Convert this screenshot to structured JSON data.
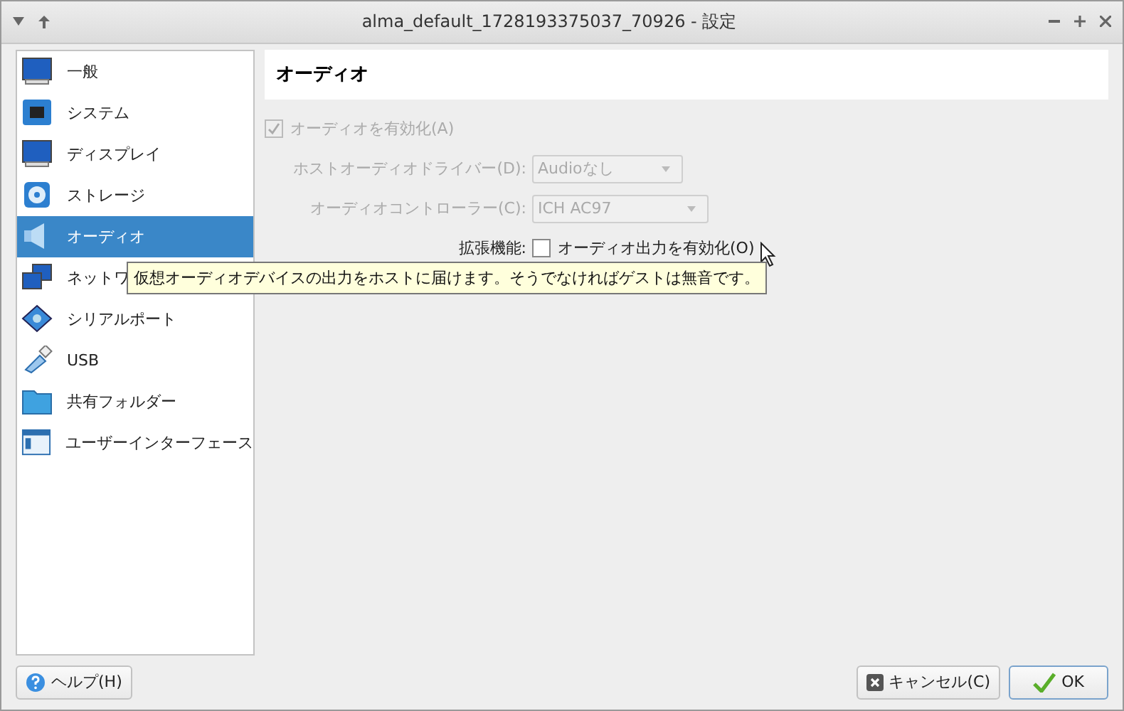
{
  "window": {
    "title": "alma_default_1728193375037_70926 - 設定"
  },
  "sidebar": {
    "items": [
      {
        "label": "一般",
        "selected": false
      },
      {
        "label": "システム",
        "selected": false
      },
      {
        "label": "ディスプレイ",
        "selected": false
      },
      {
        "label": "ストレージ",
        "selected": false
      },
      {
        "label": "オーディオ",
        "selected": true
      },
      {
        "label": "ネットワ",
        "selected": false
      },
      {
        "label": "シリアルポート",
        "selected": false
      },
      {
        "label": "USB",
        "selected": false
      },
      {
        "label": "共有フォルダー",
        "selected": false
      },
      {
        "label": "ユーザーインターフェース",
        "selected": false
      }
    ]
  },
  "page": {
    "title": "オーディオ",
    "enable_audio": {
      "label": "オーディオを有効化(A)",
      "checked": true,
      "disabled": true
    },
    "host_driver": {
      "label": "ホストオーディオドライバー(D):",
      "value": "Audioなし",
      "disabled": true
    },
    "controller": {
      "label": "オーディオコントローラー(C):",
      "value": "ICH AC97",
      "disabled": true
    },
    "extended": {
      "label": "拡張機能:",
      "option": "オーディオ出力を有効化(O)",
      "checked": false
    }
  },
  "tooltip": "仮想オーディオデバイスの出力をホストに届けます。そうでなければゲストは無音です。",
  "buttons": {
    "help": "ヘルプ(H)",
    "cancel": "キャンセル(C)",
    "ok": "OK"
  }
}
